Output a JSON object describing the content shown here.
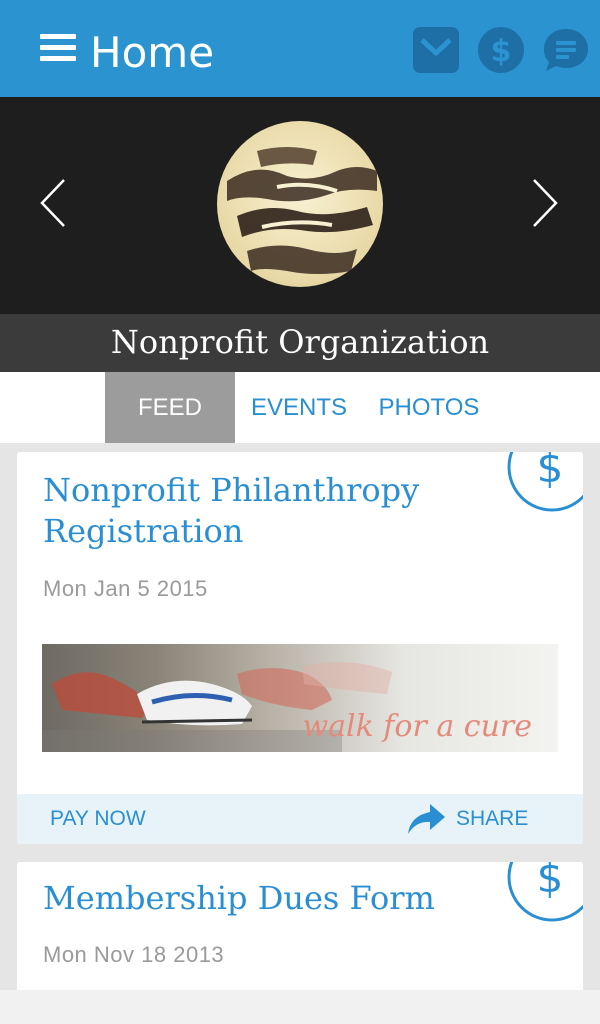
{
  "header": {
    "title": "Home",
    "menu_icon": "hamburger-menu-icon",
    "actions": [
      {
        "name": "mail",
        "icon": "envelope-icon"
      },
      {
        "name": "donate",
        "icon": "dollar-icon"
      },
      {
        "name": "chat",
        "icon": "chat-bubble-icon"
      }
    ],
    "color": "#2b93cf"
  },
  "hero": {
    "organization_name": "Nonprofit Organization",
    "prev_icon": "chevron-left-icon",
    "next_icon": "chevron-right-icon"
  },
  "tabs": [
    {
      "label": "FEED",
      "active": true
    },
    {
      "label": "EVENTS",
      "active": false
    },
    {
      "label": "PHOTOS",
      "active": false
    }
  ],
  "feed": [
    {
      "title": "Nonprofit Philanthropy Registration",
      "date": "Mon Jan 5 2015",
      "image_caption": "walk for a cure",
      "badge_icon": "dollar-icon",
      "actions": {
        "pay": "PAY NOW",
        "share": "SHARE"
      }
    },
    {
      "title": "Membership Dues Form",
      "date": "Mon Nov 18 2013",
      "badge_icon": "dollar-icon"
    }
  ],
  "colors": {
    "accent": "#2a8fd2",
    "active_tab": "#9c9c9c",
    "hero_bg": "#1e1e1e",
    "action_bar": "#e8f3f9"
  }
}
